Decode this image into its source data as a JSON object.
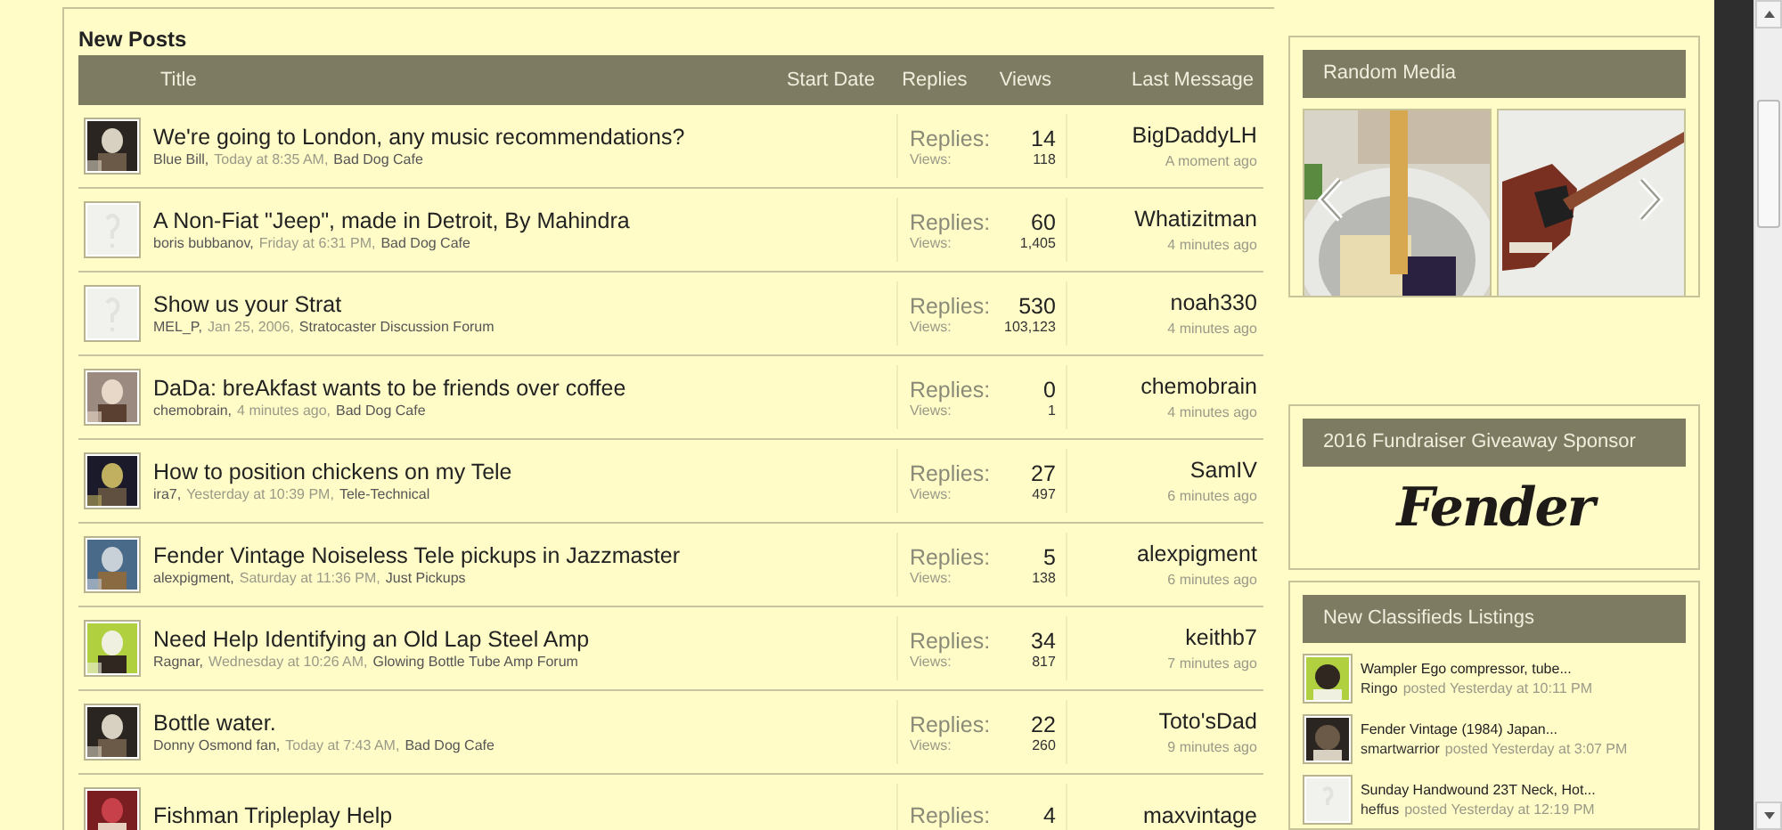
{
  "new_posts": {
    "heading": "New Posts",
    "columns": [
      "Title",
      "Start Date",
      "Replies",
      "Views",
      "Last Message"
    ],
    "rows": [
      {
        "default_avatar": false,
        "title": "We're going to London, any music recommendations?",
        "author": "Blue Bill,",
        "date": "Today at 8:35 AM,",
        "forum": "Bad Dog Cafe",
        "replies_label": "Replies:",
        "replies": "14",
        "views_label": "Views:",
        "views": "118",
        "last_user": "BigDaddyLH",
        "last_time": "A moment ago"
      },
      {
        "default_avatar": true,
        "title": "A Non-Fiat \"Jeep\", made in Detroit, By Mahindra",
        "author": "boris bubbanov,",
        "date": "Friday at 6:31 PM,",
        "forum": "Bad Dog Cafe",
        "replies_label": "Replies:",
        "replies": "60",
        "views_label": "Views:",
        "views": "1,405",
        "last_user": "Whatizitman",
        "last_time": "4 minutes ago"
      },
      {
        "default_avatar": true,
        "title": "Show us your Strat",
        "author": "MEL_P,",
        "date": "Jan 25, 2006,",
        "forum": "Stratocaster Discussion Forum",
        "replies_label": "Replies:",
        "replies": "530",
        "views_label": "Views:",
        "views": "103,123",
        "last_user": "noah330",
        "last_time": "4 minutes ago"
      },
      {
        "default_avatar": false,
        "title": "DaDa: breAkfast wants to be friends over coffee",
        "author": "chemobrain,",
        "date": "4 minutes ago,",
        "forum": "Bad Dog Cafe",
        "replies_label": "Replies:",
        "replies": "0",
        "views_label": "Views:",
        "views": "1",
        "last_user": "chemobrain",
        "last_time": "4 minutes ago"
      },
      {
        "default_avatar": false,
        "title": "How to position chickens on my Tele",
        "author": "ira7,",
        "date": "Yesterday at 10:39 PM,",
        "forum": "Tele-Technical",
        "replies_label": "Replies:",
        "replies": "27",
        "views_label": "Views:",
        "views": "497",
        "last_user": "SamIV",
        "last_time": "6 minutes ago"
      },
      {
        "default_avatar": false,
        "title": "Fender Vintage Noiseless Tele pickups in Jazzmaster",
        "author": "alexpigment,",
        "date": "Saturday at 11:36 PM,",
        "forum": "Just Pickups",
        "replies_label": "Replies:",
        "replies": "5",
        "views_label": "Views:",
        "views": "138",
        "last_user": "alexpigment",
        "last_time": "6 minutes ago"
      },
      {
        "default_avatar": false,
        "title": "Need Help Identifying an Old Lap Steel Amp",
        "author": "Ragnar,",
        "date": "Wednesday at 10:26 AM,",
        "forum": "Glowing Bottle Tube Amp Forum",
        "replies_label": "Replies:",
        "replies": "34",
        "views_label": "Views:",
        "views": "817",
        "last_user": "keithb7",
        "last_time": "7 minutes ago"
      },
      {
        "default_avatar": false,
        "title": "Bottle water.",
        "author": "Donny Osmond fan,",
        "date": "Today at 7:43 AM,",
        "forum": "Bad Dog Cafe",
        "replies_label": "Replies:",
        "replies": "22",
        "views_label": "Views:",
        "views": "260",
        "last_user": "Toto'sDad",
        "last_time": "9 minutes ago"
      },
      {
        "default_avatar": false,
        "title": "Fishman Tripleplay Help",
        "replies_label": "Replies:",
        "replies": "4",
        "last_user": "maxvintage"
      }
    ]
  },
  "random_media": {
    "heading": "Random Media"
  },
  "sponsor": {
    "heading": "2016 Fundraiser Giveaway Sponsor",
    "logo": "Fender"
  },
  "classifieds": {
    "heading": "New Classifieds Listings",
    "items": [
      {
        "default_avatar": false,
        "title": "Wampler Ego compressor, tube...",
        "user": "Ringo",
        "posted": "posted",
        "time": "Yesterday at 10:11 PM"
      },
      {
        "default_avatar": false,
        "title": "Fender Vintage (1984) Japan...",
        "user": "smartwarrior",
        "posted": "posted",
        "time": "Yesterday at 3:07 PM"
      },
      {
        "default_avatar": true,
        "title": "Sunday Handwound 23T Neck, Hot...",
        "user": "heffus",
        "posted": "posted",
        "time": "Yesterday at 12:19 PM"
      }
    ]
  }
}
